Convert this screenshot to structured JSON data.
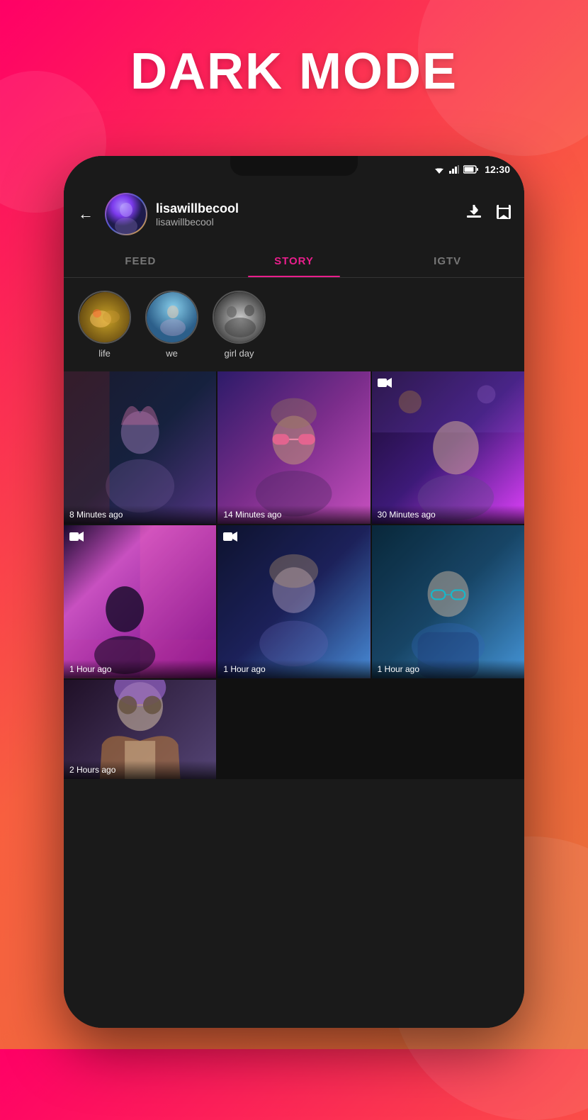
{
  "page": {
    "title": "DARK MODE",
    "background_gradient": "linear-gradient(135deg, #f06, #f96040, #e8703a)"
  },
  "status_bar": {
    "time": "12:30"
  },
  "profile": {
    "name": "lisawillbecool",
    "username": "lisawillbecool",
    "back_label": "←"
  },
  "tabs": [
    {
      "label": "FEED",
      "active": false
    },
    {
      "label": "STORY",
      "active": true
    },
    {
      "label": "IGTV",
      "active": false
    }
  ],
  "stories": [
    {
      "label": "life"
    },
    {
      "label": "we"
    },
    {
      "label": "girl day"
    }
  ],
  "media_items": [
    {
      "id": 1,
      "time_label": "8 Minutes ago",
      "is_video": false
    },
    {
      "id": 2,
      "time_label": "14 Minutes ago",
      "is_video": false
    },
    {
      "id": 3,
      "time_label": "30 Minutes ago",
      "is_video": true
    },
    {
      "id": 4,
      "time_label": "1 Hour ago",
      "is_video": true
    },
    {
      "id": 5,
      "time_label": "1 Hour ago",
      "is_video": true
    },
    {
      "id": 6,
      "time_label": "1 Hour ago",
      "is_video": false
    },
    {
      "id": 7,
      "time_label": "2 Hours ago",
      "is_video": false
    }
  ]
}
